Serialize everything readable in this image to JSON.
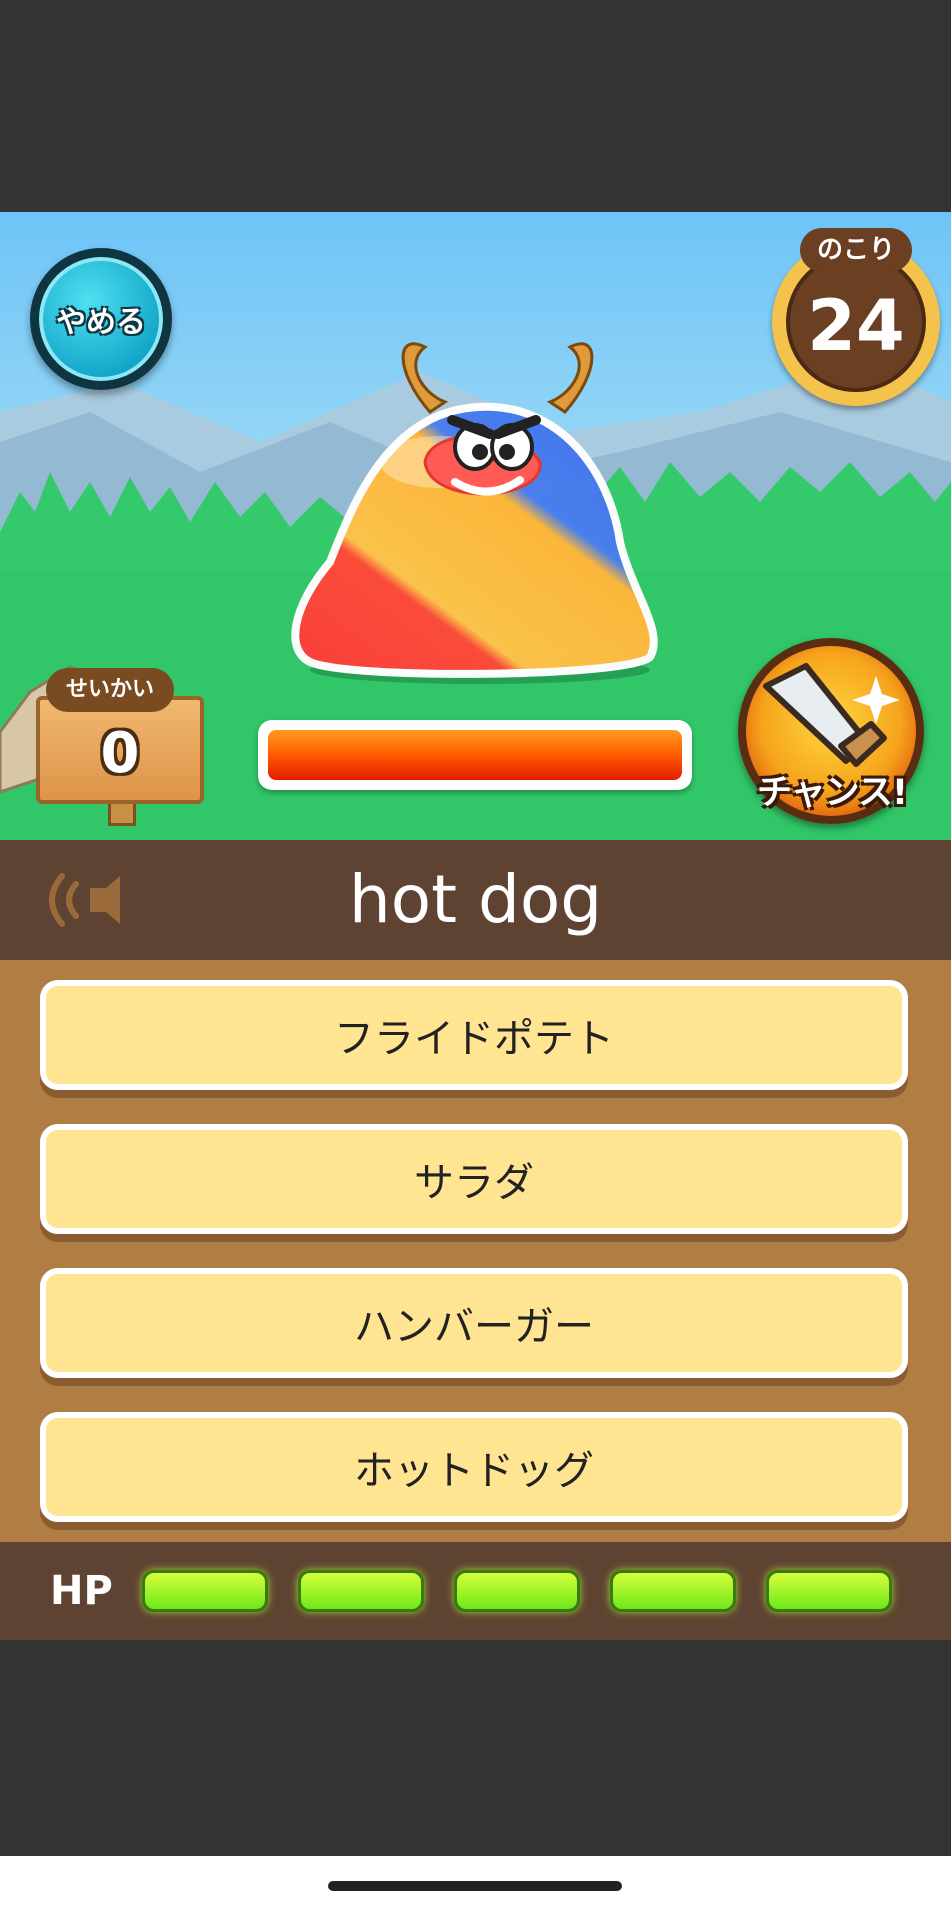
{
  "top": {
    "quit_label": "やめる",
    "remaining_label": "のこり",
    "remaining_value": "24"
  },
  "score": {
    "label": "せいかい",
    "value": "0"
  },
  "enemy": {
    "hp_fraction": 1.0
  },
  "chance": {
    "label": "チャンス!"
  },
  "question": {
    "word": "hot dog",
    "speaker_icon": "speaker-icon"
  },
  "answers": [
    {
      "label": "フライドポテト"
    },
    {
      "label": "サラダ"
    },
    {
      "label": "ハンバーガー"
    },
    {
      "label": "ホットドッグ"
    }
  ],
  "player": {
    "hp_label": "HP",
    "hp_total": 5,
    "hp_remaining": 5
  },
  "colors": {
    "scene_sky": "#6ec4f7",
    "grass": "#33c96a",
    "panel_brown": "#5f4332",
    "answer_bg": "#b07d45",
    "answer_button": "#ffe591",
    "hp_green": "#8cf52a",
    "quit_button": "#14a6c8"
  }
}
